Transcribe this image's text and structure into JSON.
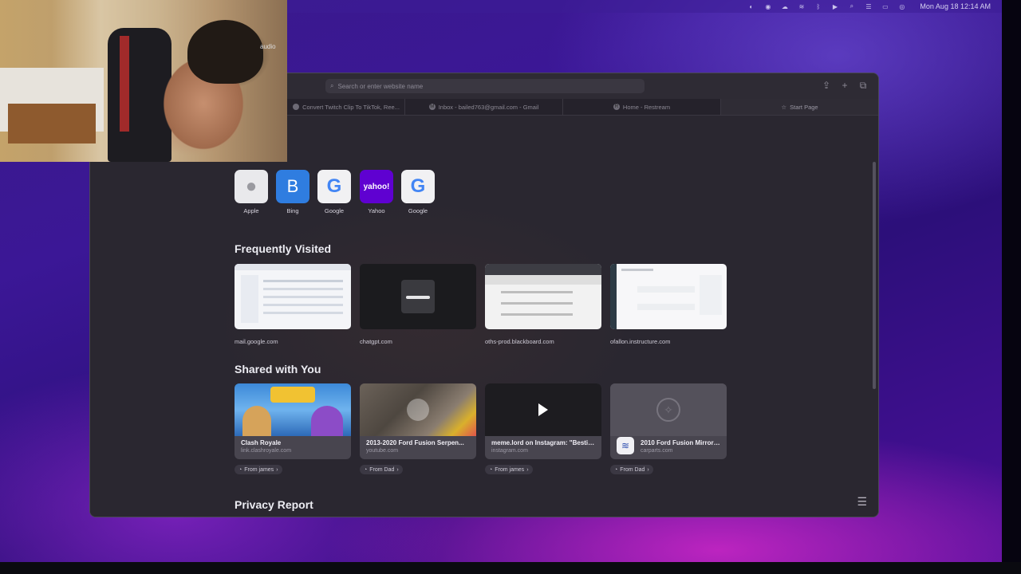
{
  "menubar": {
    "clock": "Mon Aug 18  12:14 AM"
  },
  "webcam": {
    "mic_label": "audio"
  },
  "safari": {
    "address_placeholder": "Search or enter website name",
    "tabs": [
      {
        "label": "Convert Twitch Clip To TikTok, Ree...",
        "icon": "page-icon"
      },
      {
        "label": "Inbox - bailed763@gmail.com - Gmail",
        "icon": "gmail-icon"
      },
      {
        "label": "Home - Restream",
        "icon": "restream-icon"
      },
      {
        "label": "Start Page",
        "icon": "star-icon"
      }
    ],
    "favorites": [
      {
        "label": "Apple",
        "glyph": "",
        "color": "#e9e9ec"
      },
      {
        "label": "Bing",
        "glyph": "B",
        "color": "#2f7de0"
      },
      {
        "label": "Google",
        "glyph": "G",
        "color": "#f1f1f3"
      },
      {
        "label": "Yahoo",
        "glyph": "yahoo!",
        "color": "#5f01d1"
      },
      {
        "label": "Google",
        "glyph": "G",
        "color": "#f1f1f3"
      }
    ],
    "frequently_visited": {
      "title": "Frequently Visited",
      "items": [
        {
          "label": "mail.google.com"
        },
        {
          "label": "chatgpt.com"
        },
        {
          "label": "oths-prod.blackboard.com"
        },
        {
          "label": "ofallon.instructure.com"
        }
      ]
    },
    "shared_with_you": {
      "title": "Shared with You",
      "items": [
        {
          "title": "Clash Royale",
          "domain": "link.clashroyale.com",
          "from": "From james"
        },
        {
          "title": "2013-2020 Ford Fusion Serpen...",
          "domain": "youtube.com",
          "from": "From Dad"
        },
        {
          "title": "meme.lord on Instagram: \"Bestie is...",
          "domain": "instagram.com",
          "from": "From james"
        },
        {
          "title": "2010 Ford Fusion Mirrors f...",
          "domain": "carparts.com",
          "from": "From Dad"
        }
      ]
    },
    "privacy_report": {
      "title": "Privacy Report"
    }
  }
}
